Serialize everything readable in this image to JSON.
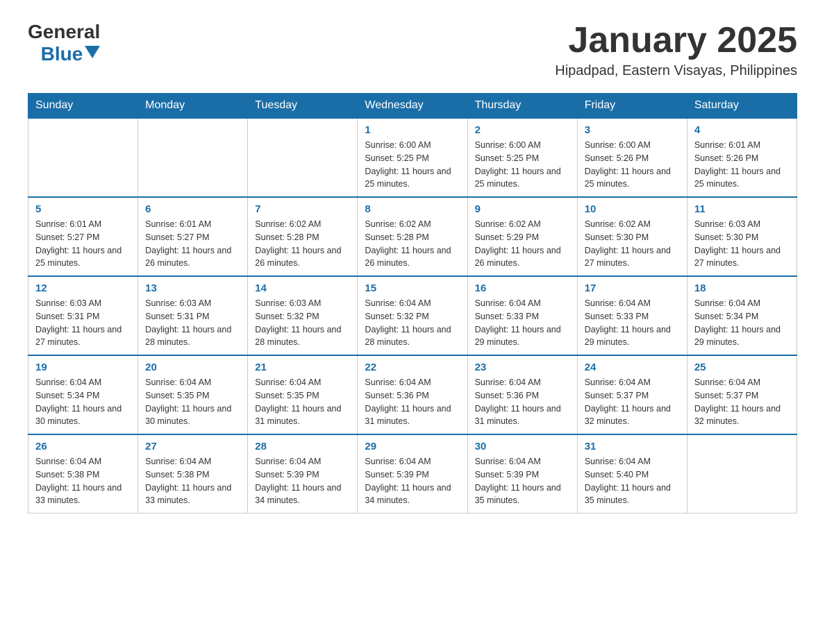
{
  "header": {
    "logo_general": "General",
    "logo_blue": "Blue",
    "month_title": "January 2025",
    "location": "Hipadpad, Eastern Visayas, Philippines"
  },
  "weekdays": [
    "Sunday",
    "Monday",
    "Tuesday",
    "Wednesday",
    "Thursday",
    "Friday",
    "Saturday"
  ],
  "weeks": [
    [
      {
        "day": "",
        "info": ""
      },
      {
        "day": "",
        "info": ""
      },
      {
        "day": "",
        "info": ""
      },
      {
        "day": "1",
        "info": "Sunrise: 6:00 AM\nSunset: 5:25 PM\nDaylight: 11 hours and 25 minutes."
      },
      {
        "day": "2",
        "info": "Sunrise: 6:00 AM\nSunset: 5:25 PM\nDaylight: 11 hours and 25 minutes."
      },
      {
        "day": "3",
        "info": "Sunrise: 6:00 AM\nSunset: 5:26 PM\nDaylight: 11 hours and 25 minutes."
      },
      {
        "day": "4",
        "info": "Sunrise: 6:01 AM\nSunset: 5:26 PM\nDaylight: 11 hours and 25 minutes."
      }
    ],
    [
      {
        "day": "5",
        "info": "Sunrise: 6:01 AM\nSunset: 5:27 PM\nDaylight: 11 hours and 25 minutes."
      },
      {
        "day": "6",
        "info": "Sunrise: 6:01 AM\nSunset: 5:27 PM\nDaylight: 11 hours and 26 minutes."
      },
      {
        "day": "7",
        "info": "Sunrise: 6:02 AM\nSunset: 5:28 PM\nDaylight: 11 hours and 26 minutes."
      },
      {
        "day": "8",
        "info": "Sunrise: 6:02 AM\nSunset: 5:28 PM\nDaylight: 11 hours and 26 minutes."
      },
      {
        "day": "9",
        "info": "Sunrise: 6:02 AM\nSunset: 5:29 PM\nDaylight: 11 hours and 26 minutes."
      },
      {
        "day": "10",
        "info": "Sunrise: 6:02 AM\nSunset: 5:30 PM\nDaylight: 11 hours and 27 minutes."
      },
      {
        "day": "11",
        "info": "Sunrise: 6:03 AM\nSunset: 5:30 PM\nDaylight: 11 hours and 27 minutes."
      }
    ],
    [
      {
        "day": "12",
        "info": "Sunrise: 6:03 AM\nSunset: 5:31 PM\nDaylight: 11 hours and 27 minutes."
      },
      {
        "day": "13",
        "info": "Sunrise: 6:03 AM\nSunset: 5:31 PM\nDaylight: 11 hours and 28 minutes."
      },
      {
        "day": "14",
        "info": "Sunrise: 6:03 AM\nSunset: 5:32 PM\nDaylight: 11 hours and 28 minutes."
      },
      {
        "day": "15",
        "info": "Sunrise: 6:04 AM\nSunset: 5:32 PM\nDaylight: 11 hours and 28 minutes."
      },
      {
        "day": "16",
        "info": "Sunrise: 6:04 AM\nSunset: 5:33 PM\nDaylight: 11 hours and 29 minutes."
      },
      {
        "day": "17",
        "info": "Sunrise: 6:04 AM\nSunset: 5:33 PM\nDaylight: 11 hours and 29 minutes."
      },
      {
        "day": "18",
        "info": "Sunrise: 6:04 AM\nSunset: 5:34 PM\nDaylight: 11 hours and 29 minutes."
      }
    ],
    [
      {
        "day": "19",
        "info": "Sunrise: 6:04 AM\nSunset: 5:34 PM\nDaylight: 11 hours and 30 minutes."
      },
      {
        "day": "20",
        "info": "Sunrise: 6:04 AM\nSunset: 5:35 PM\nDaylight: 11 hours and 30 minutes."
      },
      {
        "day": "21",
        "info": "Sunrise: 6:04 AM\nSunset: 5:35 PM\nDaylight: 11 hours and 31 minutes."
      },
      {
        "day": "22",
        "info": "Sunrise: 6:04 AM\nSunset: 5:36 PM\nDaylight: 11 hours and 31 minutes."
      },
      {
        "day": "23",
        "info": "Sunrise: 6:04 AM\nSunset: 5:36 PM\nDaylight: 11 hours and 31 minutes."
      },
      {
        "day": "24",
        "info": "Sunrise: 6:04 AM\nSunset: 5:37 PM\nDaylight: 11 hours and 32 minutes."
      },
      {
        "day": "25",
        "info": "Sunrise: 6:04 AM\nSunset: 5:37 PM\nDaylight: 11 hours and 32 minutes."
      }
    ],
    [
      {
        "day": "26",
        "info": "Sunrise: 6:04 AM\nSunset: 5:38 PM\nDaylight: 11 hours and 33 minutes."
      },
      {
        "day": "27",
        "info": "Sunrise: 6:04 AM\nSunset: 5:38 PM\nDaylight: 11 hours and 33 minutes."
      },
      {
        "day": "28",
        "info": "Sunrise: 6:04 AM\nSunset: 5:39 PM\nDaylight: 11 hours and 34 minutes."
      },
      {
        "day": "29",
        "info": "Sunrise: 6:04 AM\nSunset: 5:39 PM\nDaylight: 11 hours and 34 minutes."
      },
      {
        "day": "30",
        "info": "Sunrise: 6:04 AM\nSunset: 5:39 PM\nDaylight: 11 hours and 35 minutes."
      },
      {
        "day": "31",
        "info": "Sunrise: 6:04 AM\nSunset: 5:40 PM\nDaylight: 11 hours and 35 minutes."
      },
      {
        "day": "",
        "info": ""
      }
    ]
  ]
}
